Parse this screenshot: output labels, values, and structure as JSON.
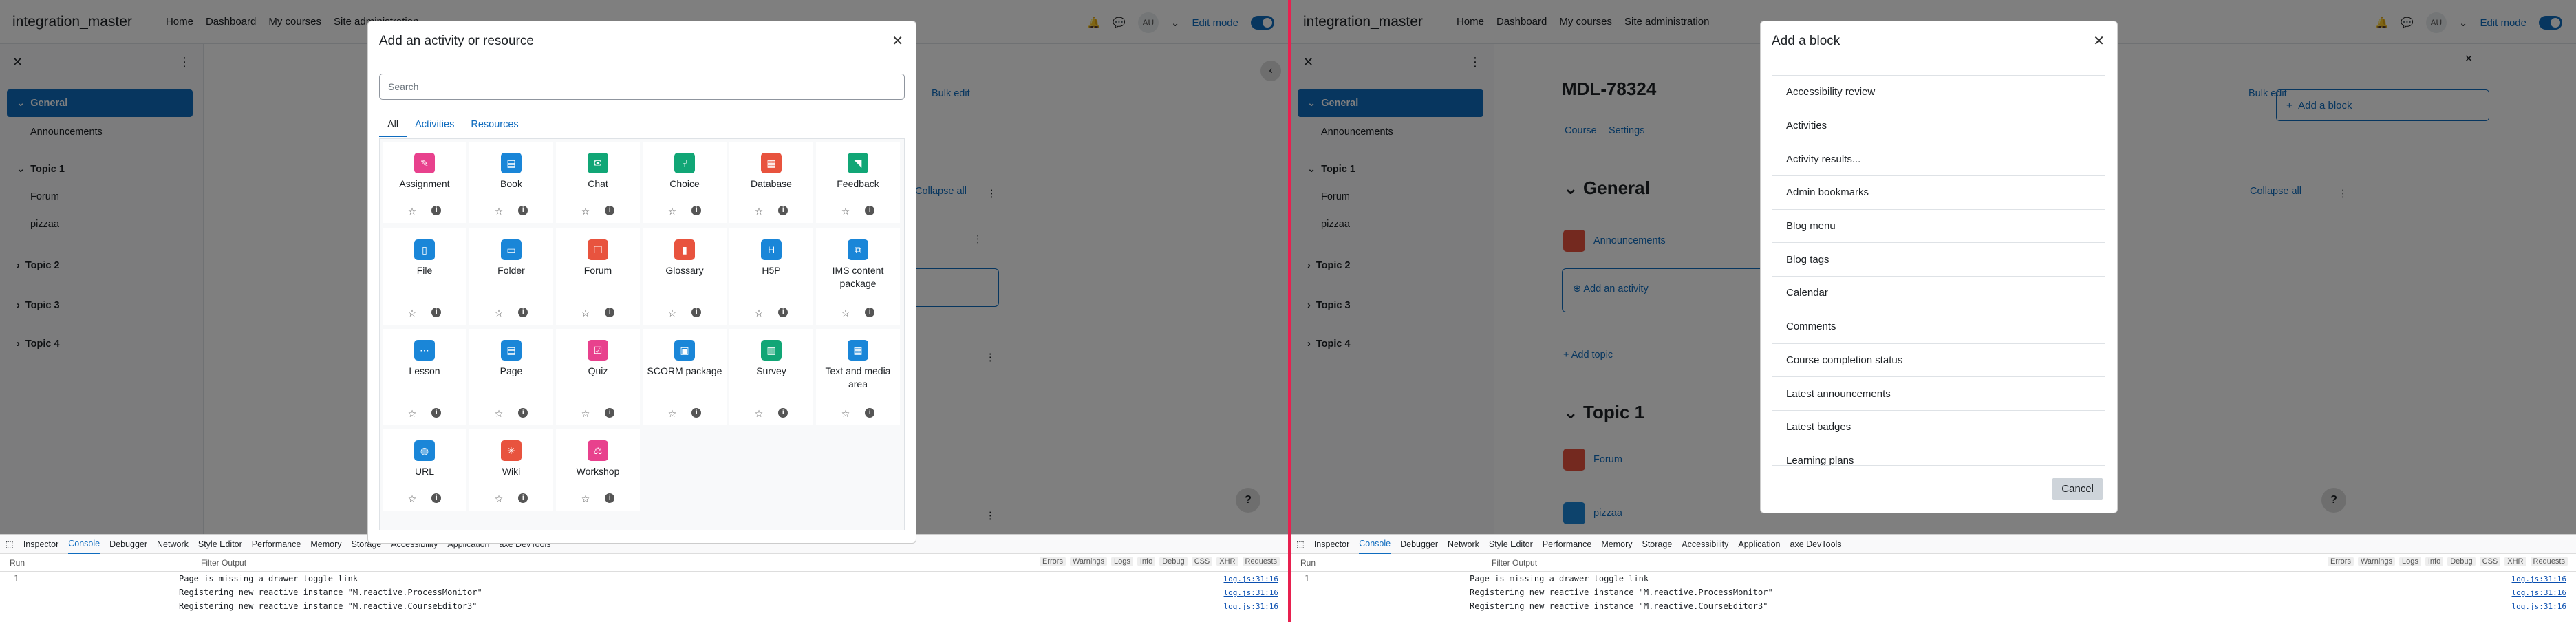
{
  "nav": {
    "brand": "integration_master",
    "links": [
      "Home",
      "Dashboard",
      "My courses",
      "Site administration"
    ],
    "avatar": "AU",
    "edit_mode": "Edit mode"
  },
  "drawer": {
    "items": [
      "General",
      "Announcements",
      "Topic 1",
      "Forum",
      "pizzaa",
      "Topic 2",
      "Topic 3",
      "Topic 4"
    ]
  },
  "left_main": {
    "bulk_edit": "Bulk edit",
    "collapse_all": "Collapse all"
  },
  "activity_modal": {
    "title": "Add an activity or resource",
    "search_placeholder": "Search",
    "tabs": [
      "All",
      "Activities",
      "Resources"
    ],
    "tiles": [
      {
        "name": "Assignment",
        "color": "#e8418d",
        "glyph": "✎"
      },
      {
        "name": "Book",
        "color": "#1a86d8",
        "glyph": "▤"
      },
      {
        "name": "Chat",
        "color": "#11a676",
        "glyph": "✉"
      },
      {
        "name": "Choice",
        "color": "#11a676",
        "glyph": "⑂"
      },
      {
        "name": "Database",
        "color": "#e8533e",
        "glyph": "▦"
      },
      {
        "name": "Feedback",
        "color": "#11a676",
        "glyph": "◥"
      },
      {
        "name": "File",
        "color": "#1a86d8",
        "glyph": "▯"
      },
      {
        "name": "Folder",
        "color": "#1a86d8",
        "glyph": "▭"
      },
      {
        "name": "Forum",
        "color": "#e8533e",
        "glyph": "❐"
      },
      {
        "name": "Glossary",
        "color": "#e8533e",
        "glyph": "▮"
      },
      {
        "name": "H5P",
        "color": "#1a86d8",
        "glyph": "H"
      },
      {
        "name": "IMS content package",
        "color": "#1a86d8",
        "glyph": "⧉"
      },
      {
        "name": "Lesson",
        "color": "#1a86d8",
        "glyph": "⋯"
      },
      {
        "name": "Page",
        "color": "#1a86d8",
        "glyph": "▤"
      },
      {
        "name": "Quiz",
        "color": "#e8418d",
        "glyph": "☑"
      },
      {
        "name": "SCORM package",
        "color": "#1a86d8",
        "glyph": "▣"
      },
      {
        "name": "Survey",
        "color": "#11a676",
        "glyph": "▥"
      },
      {
        "name": "Text and media area",
        "color": "#1a86d8",
        "glyph": "▦"
      },
      {
        "name": "URL",
        "color": "#1a86d8",
        "glyph": "◍"
      },
      {
        "name": "Wiki",
        "color": "#e8533e",
        "glyph": "✳"
      },
      {
        "name": "Workshop",
        "color": "#e8418d",
        "glyph": "⚖"
      }
    ]
  },
  "right_main": {
    "course_title": "MDL-78324",
    "tabs": [
      "Course",
      "Settings"
    ],
    "general": "General",
    "announcements": "Announcements",
    "add_activity": "Add an activity",
    "add_topic": "Add topic",
    "topic1": "Topic 1",
    "forum": "Forum",
    "pizzaa": "pizzaa",
    "add_block": "Add a block",
    "bulk_edit": "Bulk edit",
    "collapse_all": "Collapse all"
  },
  "block_modal": {
    "title": "Add a block",
    "items": [
      "Accessibility review",
      "Activities",
      "Activity results...",
      "Admin bookmarks",
      "Blog menu",
      "Blog tags",
      "Calendar",
      "Comments",
      "Course completion status",
      "Latest announcements",
      "Latest badges",
      "Learning plans"
    ],
    "cancel": "Cancel"
  },
  "devtools": {
    "tabs": [
      "Inspector",
      "Console",
      "Debugger",
      "Network",
      "Style Editor",
      "Performance",
      "Memory",
      "Storage",
      "Accessibility",
      "Application",
      "axe DevTools"
    ],
    "run": "Run",
    "filter_placeholder": "Filter Output",
    "filters": [
      "Errors",
      "Warnings",
      "Logs",
      "Info",
      "Debug",
      "CSS",
      "XHR",
      "Requests"
    ],
    "line_number": "1",
    "messages": [
      {
        "text": "Page is missing a drawer toggle link",
        "loc": "log.js:31:16"
      },
      {
        "text": "Registering new reactive instance \"M.reactive.ProcessMonitor\"",
        "loc": "log.js:31:16"
      },
      {
        "text": "Registering new reactive instance \"M.reactive.CourseEditor3\"",
        "loc": "log.js:31:16"
      }
    ]
  }
}
